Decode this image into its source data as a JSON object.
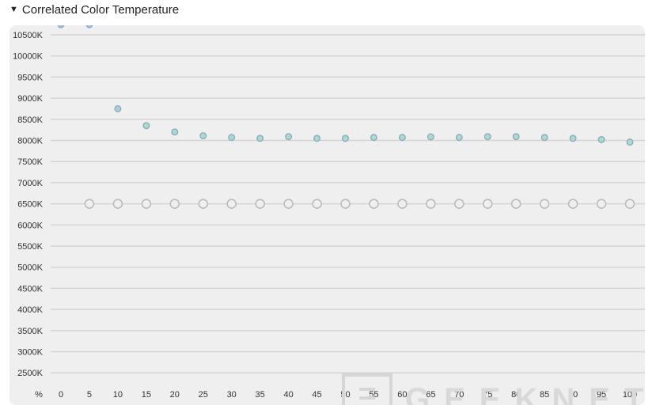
{
  "section": {
    "title": "Correlated Color Temperature",
    "toggle_icon": "triangle-down-icon"
  },
  "watermark": "GEEKNETIC",
  "chart_data": {
    "type": "scatter",
    "title": "",
    "xlabel": "%",
    "ylabel": "",
    "x": [
      0,
      5,
      10,
      15,
      20,
      25,
      30,
      35,
      40,
      45,
      50,
      55,
      60,
      65,
      70,
      75,
      80,
      85,
      90,
      95,
      100
    ],
    "x_ticks": [
      "0",
      "5",
      "10",
      "15",
      "20",
      "25",
      "30",
      "35",
      "40",
      "45",
      "50",
      "55",
      "60",
      "65",
      "70",
      "75",
      "80",
      "85",
      "90",
      "95",
      "100"
    ],
    "ylim": [
      2250,
      10750
    ],
    "y_ticks": [
      2500,
      3000,
      3500,
      4000,
      4500,
      5000,
      5500,
      6000,
      6500,
      7000,
      7500,
      8000,
      8500,
      9000,
      9500,
      10000,
      10500
    ],
    "y_tick_suffix": "K",
    "grid": true,
    "series": [
      {
        "values": [
          10740,
          10740,
          8750,
          8350,
          8200,
          8110,
          8070,
          8050,
          8090,
          8050,
          8050,
          8070,
          8070,
          8085,
          8070,
          8090,
          8090,
          8070,
          8050,
          8020,
          7960
        ],
        "colors": [
          "#a9c0e6",
          "#a9c0e6",
          "#aacfe4",
          "#a8dcd2",
          "#a8dcd2",
          "#a8dcd2",
          "#a8dcd2",
          "#a8dcd2",
          "#a8dcd2",
          "#a8dcd2",
          "#a8dcd2",
          "#a8dcd2",
          "#a8dcd2",
          "#a8dcd2",
          "#a8dcd2",
          "#a8dcd2",
          "#a8dcd2",
          "#a8dcd2",
          "#a8dcd2",
          "#a8dcd2",
          "#a8dcd2"
        ],
        "stroke": "#8fa6b8"
      },
      {
        "x": [
          5,
          10,
          15,
          20,
          25,
          30,
          35,
          40,
          45,
          50,
          55,
          60,
          65,
          70,
          75,
          80,
          85,
          90,
          95,
          100
        ],
        "values": [
          6500,
          6500,
          6500,
          6500,
          6500,
          6500,
          6500,
          6500,
          6500,
          6500,
          6500,
          6500,
          6500,
          6500,
          6500,
          6500,
          6500,
          6500,
          6500,
          6500
        ],
        "style": "hollow",
        "stroke": "#b8b8b8"
      }
    ]
  }
}
